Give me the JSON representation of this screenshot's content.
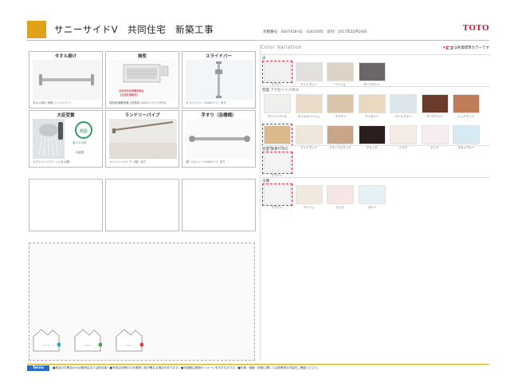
{
  "header": {
    "title": "サニーサイドV　共同住宅　新築工事",
    "meta": "見積番号：SS07418-02　ILSU1005　日付：2017年02月24日",
    "brand": "TOTO"
  },
  "options": [
    {
      "label": "タオル掛け",
      "caption": "タオル掛け 両側（ハンドバー）"
    },
    {
      "label": "換気",
      "caption": "換気乾燥暖房機 1室換気 100V(ドライTOPX)"
    },
    {
      "label": "スライドバー",
      "caption": "スライドバー（1000ミリ）あり"
    },
    {
      "label": "大臣受賞",
      "caption": "エアインシャワー（メタル調）"
    },
    {
      "label": "ランドリーパイプ",
      "caption": "ランドリーパイプ（Ⅰ型）あり"
    },
    {
      "label": "手すり（浴槽横）",
      "caption": "I型（ストレート600ミリ）あり"
    }
  ],
  "option_image_texts": {
    "ventilation_note1": "浴室換気乾燥暖房機は",
    "ventilation_note2": "【浴室乾燥暖房】",
    "award_text": "省エネ大賞",
    "award_sub": "大臣賞"
  },
  "color_variation": {
    "title": "Color Variation",
    "note_before": "※",
    "note_after": "は各業標準カラーです",
    "sections": [
      {
        "name": "床",
        "swatches": [
          {
            "name": "ホワイト",
            "color": "#f1f1f1",
            "selected": true
          },
          {
            "name": "ライトグレー",
            "color": "#e3e1de",
            "selected": false
          },
          {
            "name": "ベージュ",
            "color": "#ddd3c6",
            "selected": false
          },
          {
            "name": "ダークグレー",
            "color": "#6b6768",
            "selected": false
          }
        ]
      },
      {
        "name": "壁面 アクセントパネル",
        "swatches": [
          {
            "name": "ホワイトパール",
            "color": "#efefee",
            "selected": false
          },
          {
            "name": "ロイヤルベージュ",
            "color": "#e9dcc9",
            "selected": false
          },
          {
            "name": "ブラウン",
            "color": "#d9c6aa",
            "selected": false
          },
          {
            "name": "アイボリー",
            "color": "#ead9c0",
            "selected": false
          },
          {
            "name": "ペールブルー",
            "color": "#dde6ec",
            "selected": false
          },
          {
            "name": "ダークウッド",
            "color": "#6a3d2b",
            "selected": false
          },
          {
            "name": "レッドウッド",
            "color": "#c07c59",
            "selected": false
          },
          {
            "name": "ナチュラルウッド",
            "color": "#dcb98c",
            "selected": true
          },
          {
            "name": "ライトウッド",
            "color": "#efe7dc",
            "selected": false
          },
          {
            "name": "ミディアムウッド",
            "color": "#c9a58a",
            "selected": false
          },
          {
            "name": "ブラック",
            "color": "#2c1e1c",
            "selected": false
          },
          {
            "name": "ミルク",
            "color": "#f4ece4",
            "selected": false
          },
          {
            "name": "ピンク",
            "color": "#f6eeee",
            "selected": false
          },
          {
            "name": "スカイブルー",
            "color": "#d7e9f3",
            "selected": false
          }
        ]
      },
      {
        "name": "壁面 基本パネル",
        "swatches": [
          {
            "name": "ホワイト",
            "color": "#f3f3f3",
            "selected": true
          }
        ]
      },
      {
        "name": "浴槽",
        "swatches": [
          {
            "name": "ホワイト",
            "color": "#f4f4f4",
            "selected": true
          },
          {
            "name": "ベージュ",
            "color": "#f1e9de",
            "selected": false
          },
          {
            "name": "ピンク",
            "color": "#f7e6e6",
            "selected": false
          },
          {
            "name": "ブルー",
            "color": "#e6f1f5",
            "selected": false
          }
        ]
      }
    ]
  },
  "house_icons": [
    {
      "color": "#2aa4e0"
    },
    {
      "color": "#3aa84a"
    },
    {
      "color": "#e03a3a"
    }
  ],
  "footer": {
    "tag": "Tetris",
    "text": "■商品のお問合わせは販売店または担当者へ■写真は印刷のため実物と色が異なる場合があります。■本図面は実際のイメージを示すものです。■仕様・価格・詳細に関しては見積書の内容をご確認ください。"
  }
}
